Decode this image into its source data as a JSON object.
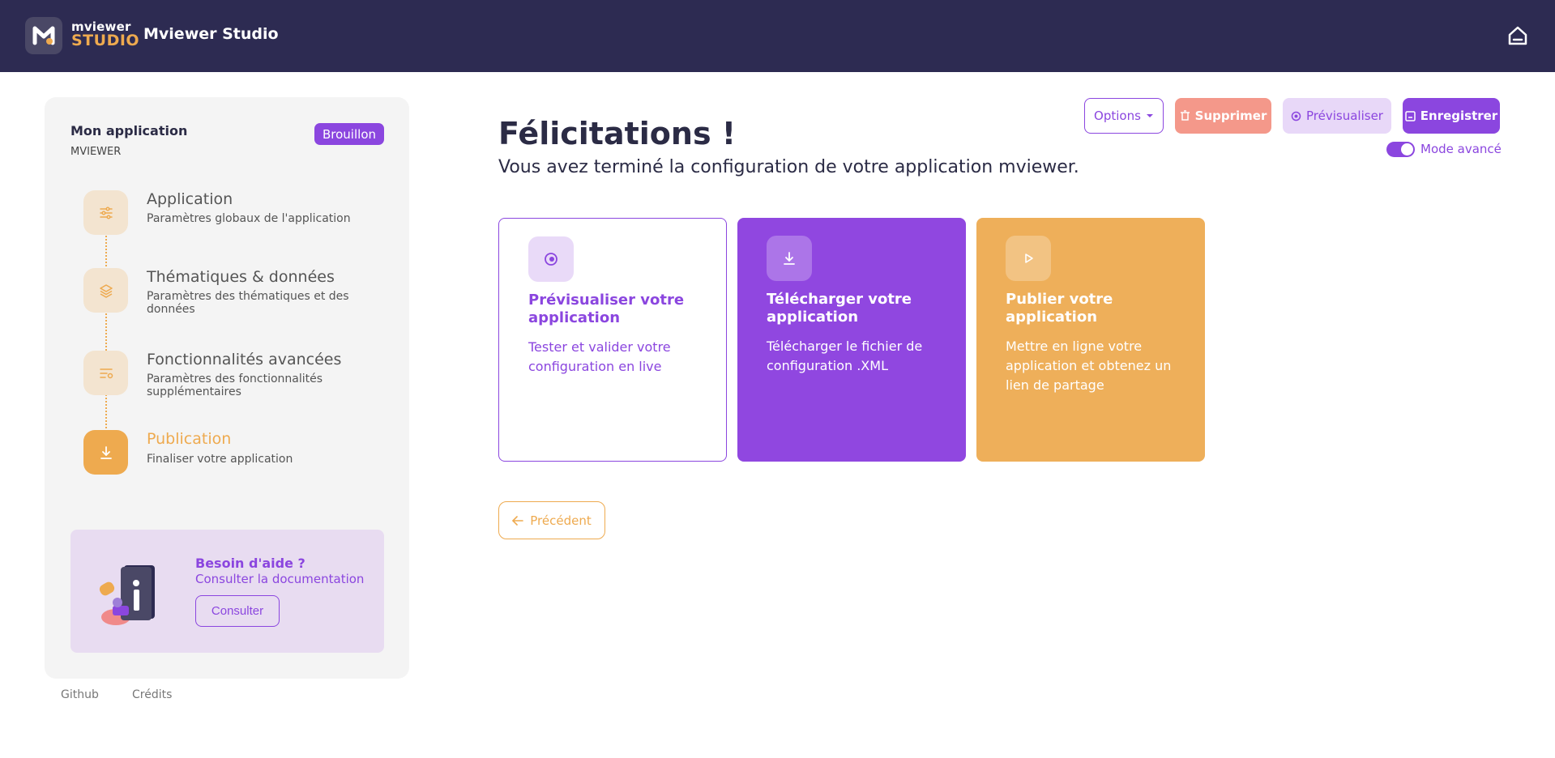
{
  "header": {
    "logo_top": "mviewer",
    "logo_bottom": "STUDIO",
    "title": "Mviewer Studio",
    "home_icon": "home-icon"
  },
  "sidebar": {
    "project_name": "Mon application",
    "project_sub": "MVIEWER",
    "status": "Brouillon",
    "steps": [
      {
        "title": "Application",
        "desc": "Paramètres globaux de l'application",
        "icon": "sliders-icon",
        "active": false
      },
      {
        "title": "Thématiques & données",
        "desc": "Paramètres des thématiques et des données",
        "icon": "layers-icon",
        "active": false
      },
      {
        "title": "Fonctionnalités avancées",
        "desc": "Paramètres des fonctionnalités supplémentaires",
        "icon": "advanced-settings-icon",
        "active": false
      },
      {
        "title": "Publication",
        "desc": "Finaliser votre application",
        "icon": "download-icon",
        "active": true
      }
    ],
    "help": {
      "title": "Besoin d'aide ?",
      "subtitle": "Consulter la documentation",
      "button": "Consulter"
    }
  },
  "footer": {
    "github": "Github",
    "credits": "Crédits"
  },
  "toolbar": {
    "options_label": "Options",
    "delete_label": "Supprimer",
    "preview_label": "Prévisualiser",
    "save_label": "Enregistrer",
    "advanced_mode_label": "Mode avancé",
    "advanced_mode_on": true
  },
  "main": {
    "title": "Félicitations !",
    "subtitle": "Vous avez terminé la configuration de votre application mviewer.",
    "cards": [
      {
        "title": "Prévisualiser votre application",
        "desc": "Tester et valider votre configuration en live",
        "icon": "eye-icon"
      },
      {
        "title": "Télécharger votre application",
        "desc": "Télécharger le fichier de configuration .XML",
        "icon": "download-icon"
      },
      {
        "title": "Publier votre application",
        "desc": "Mettre en ligne votre application et obtenez un lien de partage",
        "icon": "play-icon"
      }
    ],
    "prev_label": "Précédent"
  },
  "colors": {
    "primary": "#8b46df",
    "accent": "#eeaa4f",
    "header_bg": "#2d2b52",
    "danger": "#f4988a"
  }
}
